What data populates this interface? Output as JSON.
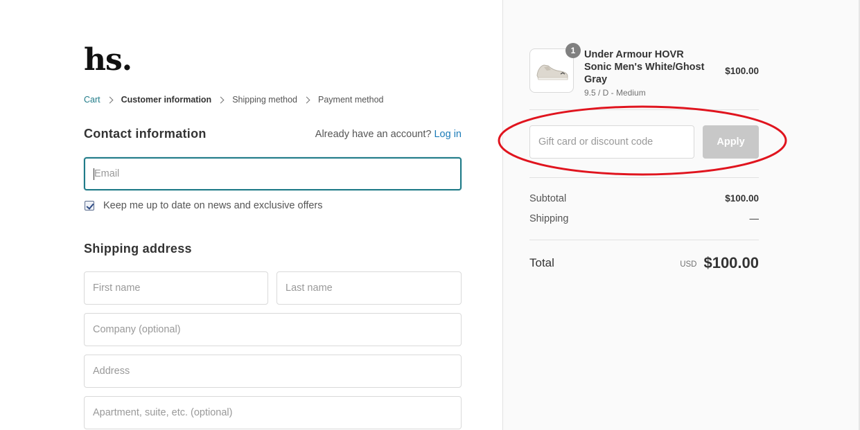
{
  "brand": {
    "logo": "hs."
  },
  "breadcrumb": {
    "cart": "Cart",
    "customer_info": "Customer information",
    "shipping_method": "Shipping method",
    "payment_method": "Payment method"
  },
  "contact": {
    "title": "Contact information",
    "account_prompt": "Already have an account?",
    "login_label": "Log in",
    "email_placeholder": "Email",
    "newsletter_label": "Keep me up to date on news and exclusive offers",
    "newsletter_checked": true
  },
  "shipping": {
    "title": "Shipping address",
    "first_name_placeholder": "First name",
    "last_name_placeholder": "Last name",
    "company_placeholder": "Company (optional)",
    "address_placeholder": "Address",
    "apartment_placeholder": "Apartment, suite, etc. (optional)"
  },
  "order": {
    "item": {
      "quantity": "1",
      "name": "Under Armour HOVR Sonic Men's White/Ghost Gray",
      "variant": "9.5 / D - Medium",
      "price": "$100.00",
      "image_icon": "shoe-icon"
    },
    "discount_placeholder": "Gift card or discount code",
    "apply_label": "Apply",
    "subtotal_label": "Subtotal",
    "subtotal_value": "$100.00",
    "shipping_label": "Shipping",
    "shipping_value": "—",
    "total_label": "Total",
    "currency": "USD",
    "total_value": "$100.00"
  },
  "colors": {
    "accent": "#1f7b88",
    "link": "#1a7bb8",
    "annotation": "#e0141e",
    "apply_disabled": "#c8c8c8"
  }
}
